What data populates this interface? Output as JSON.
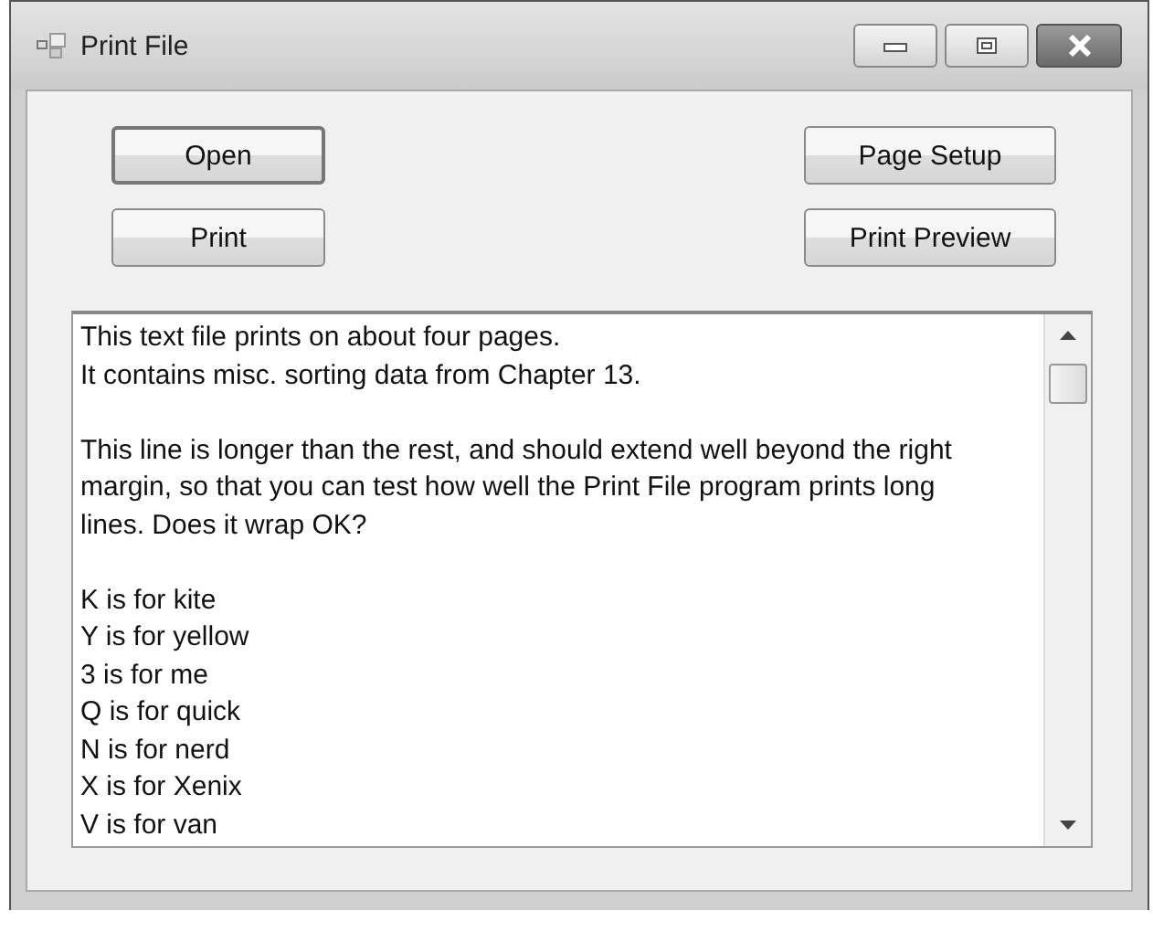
{
  "window": {
    "title": "Print File",
    "controls": [
      {
        "kind": "minimize"
      },
      {
        "kind": "maximize"
      },
      {
        "kind": "close"
      }
    ]
  },
  "buttons": [
    {
      "label": "Open",
      "focused": true
    },
    {
      "label": "Page Setup",
      "focused": false
    },
    {
      "label": "Print",
      "focused": false
    },
    {
      "label": "Print Preview",
      "focused": false
    }
  ],
  "text_box": {
    "paragraphs": [
      [
        "This text file prints on about four pages.",
        "It contains misc. sorting data from Chapter 13."
      ],
      [
        "This line is longer than the rest, and should extend well beyond the right margin, so that you can test how well the Print File program prints long lines.  Does it wrap OK?"
      ],
      [
        "K is for kite",
        "Y is for yellow",
        "3 is for me",
        "Q is for quick",
        "N is for nerd",
        "X is for Xenix",
        "V is for van"
      ]
    ]
  }
}
